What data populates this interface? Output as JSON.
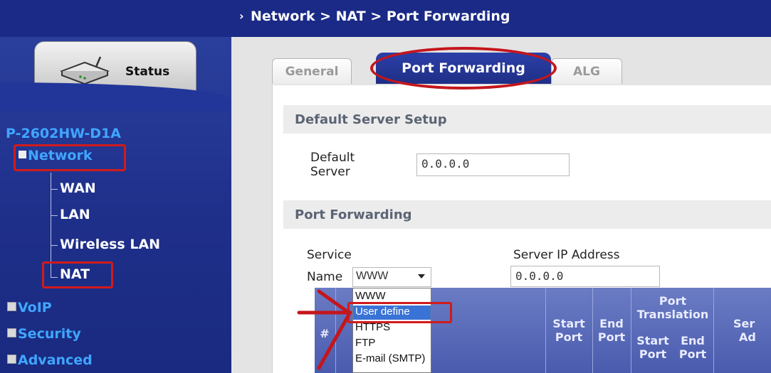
{
  "header": {
    "breadcrumb": "Network > NAT > Port Forwarding"
  },
  "sidebar": {
    "status_label": "Status",
    "model": "P-2602HW-D1A",
    "items": [
      {
        "label": "Network"
      },
      {
        "label": "WAN"
      },
      {
        "label": "LAN"
      },
      {
        "label": "Wireless LAN"
      },
      {
        "label": "NAT"
      },
      {
        "label": "VoIP"
      },
      {
        "label": "Security"
      },
      {
        "label": "Advanced"
      }
    ]
  },
  "tabs": [
    {
      "label": "General"
    },
    {
      "label": "Port Forwarding"
    },
    {
      "label": "ALG"
    }
  ],
  "default_server": {
    "section_title": "Default Server Setup",
    "label_line1": "Default",
    "label_line2": "Server",
    "value": "0.0.0.0"
  },
  "port_forwarding": {
    "section_title": "Port Forwarding",
    "service_label": "Service",
    "name_label": "Name",
    "service_selected": "WWW",
    "server_ip_label": "Server IP Address",
    "server_ip_value": "0.0.0.0",
    "dropdown_options": [
      "WWW",
      "User define",
      "HTTPS",
      "FTP",
      "E-mail (SMTP)"
    ],
    "table_headers": {
      "num": "#",
      "start_port": [
        "Start",
        "Port"
      ],
      "end_port": [
        "End",
        "Port"
      ],
      "port_translation": [
        "Port",
        "Translation"
      ],
      "trans_start": [
        "Start",
        "Port"
      ],
      "trans_end": [
        "End",
        "Port"
      ],
      "server_addr": [
        "Ser",
        "Ad"
      ]
    }
  },
  "colors": {
    "nav_blue": "#1a2a86",
    "highlight_red": "#d11b1b",
    "link_blue": "#3fa6ff"
  }
}
